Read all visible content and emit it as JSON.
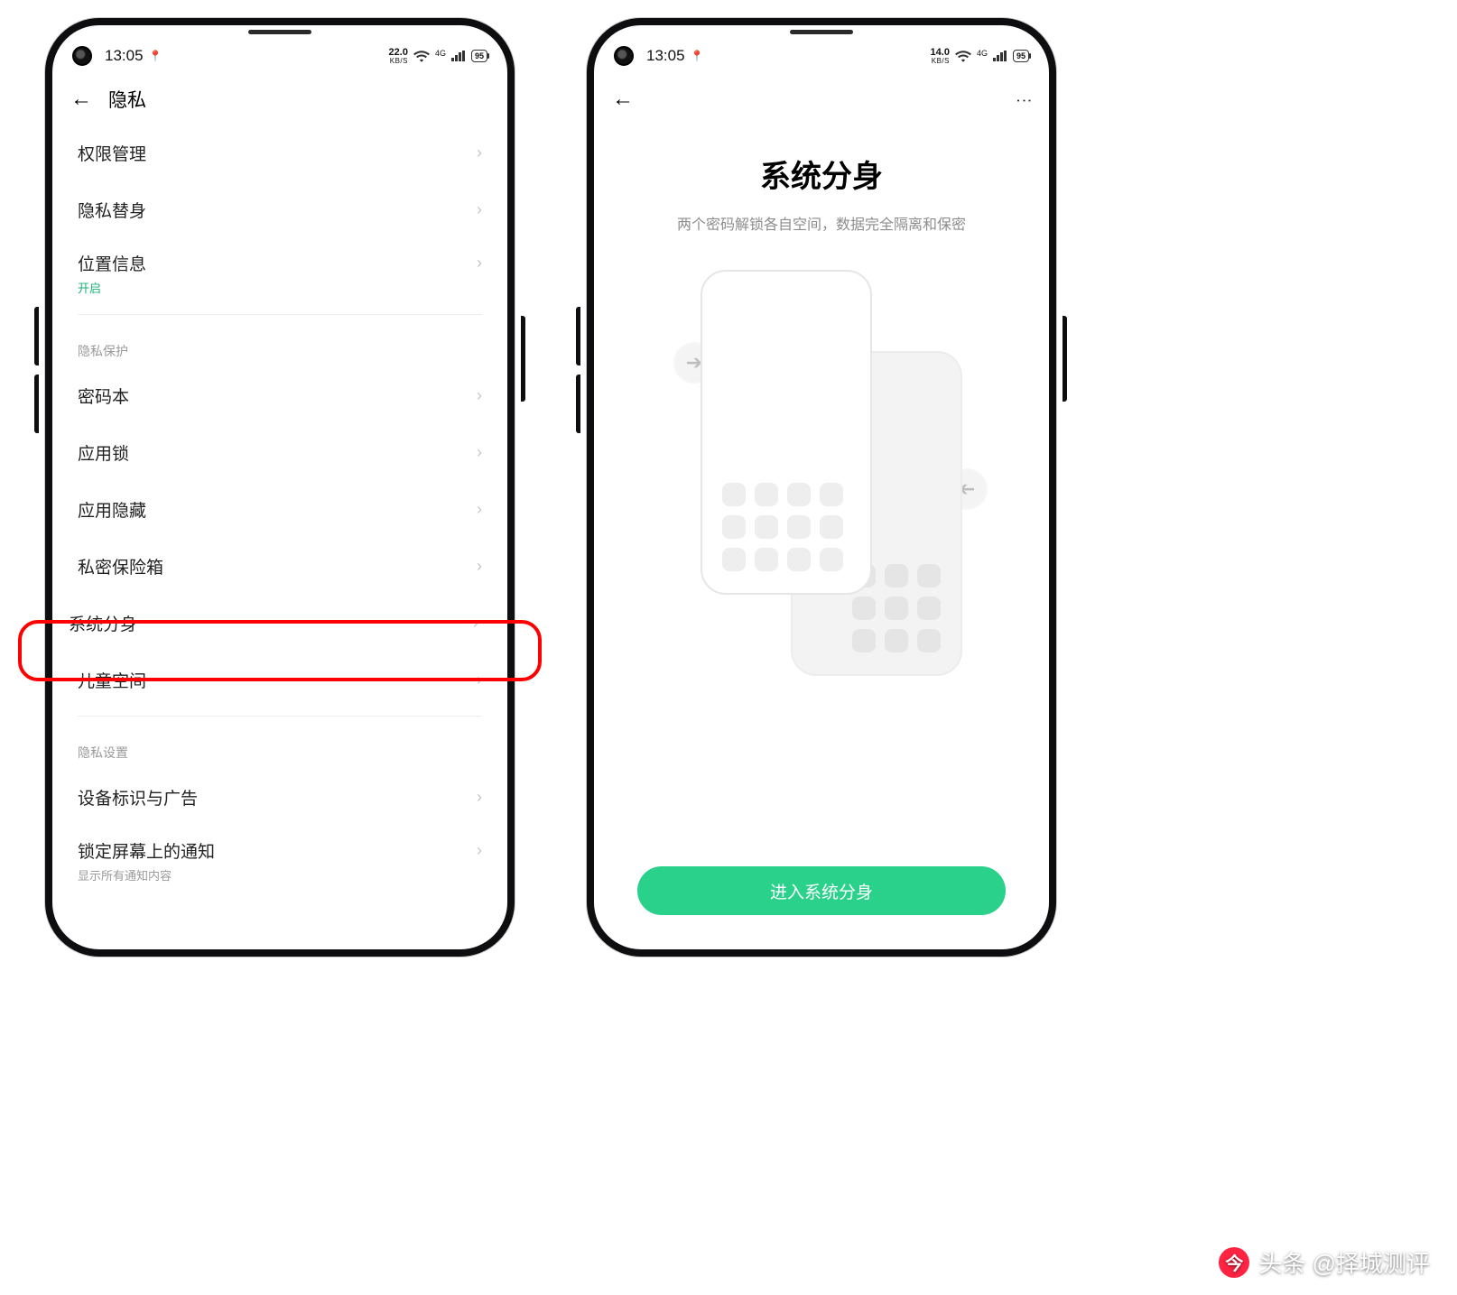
{
  "status": {
    "time": "13:05",
    "battery": "95",
    "signal_label": "4G",
    "left_kbs": "22.0",
    "left_kbs_unit": "KB/S",
    "right_kbs": "14.0",
    "right_kbs_unit": "KB/S"
  },
  "left_screen": {
    "title": "隐私",
    "rows": {
      "permissions": "权限管理",
      "privacy_sub": "隐私替身",
      "location": "位置信息",
      "location_state": "开启",
      "section_protect": "隐私保护",
      "passwords": "密码本",
      "applock": "应用锁",
      "apphide": "应用隐藏",
      "vault": "私密保险箱",
      "system_clone": "系统分身",
      "kids": "儿童空间",
      "section_settings": "隐私设置",
      "device_ad": "设备标识与广告",
      "lock_notif": "锁定屏幕上的通知",
      "lock_notif_sub": "显示所有通知内容"
    }
  },
  "right_screen": {
    "title": "系统分身",
    "subtitle": "两个密码解锁各自空间，数据完全隔离和保密",
    "cta": "进入系统分身"
  },
  "watermark": "头条 @择城测评"
}
